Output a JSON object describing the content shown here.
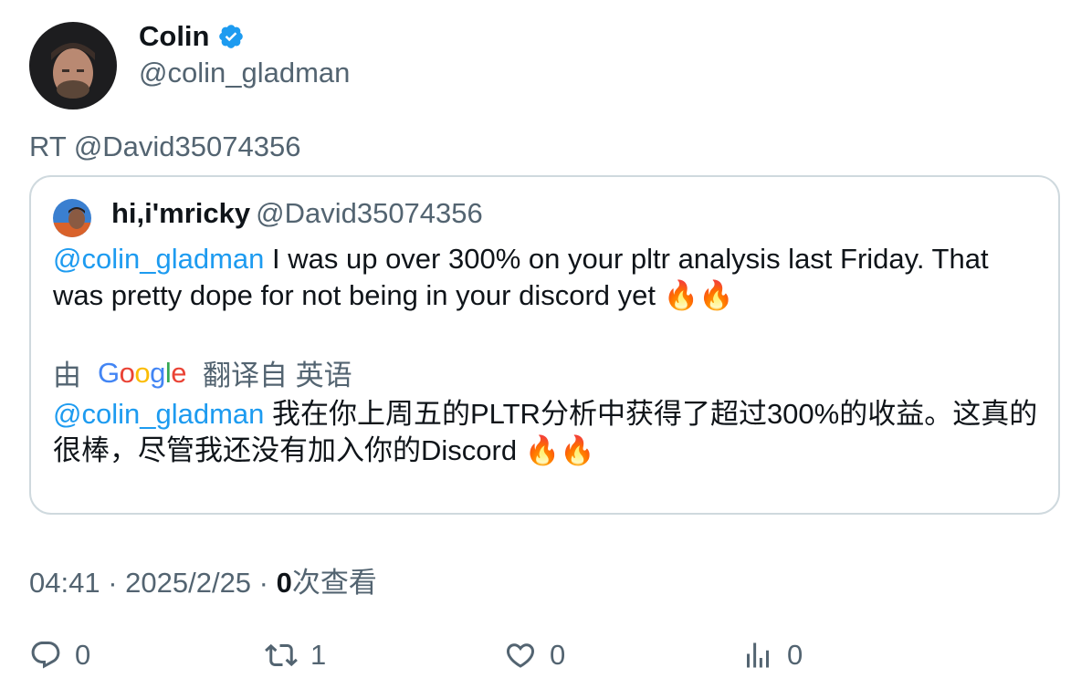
{
  "author": {
    "name": "Colin",
    "handle": "@colin_gladman"
  },
  "retweet_label": "RT @David35074356",
  "quoted": {
    "name": "hi,i'mricky",
    "handle": "@David35074356",
    "mention": "@colin_gladman",
    "text": " I was up over 300% on your pltr analysis last Friday. That was pretty dope for not being in your discord yet 🔥🔥",
    "translate_prefix": "由",
    "translate_brand": "Google",
    "translate_suffix": "翻译自 英语",
    "translated_mention": "@colin_gladman",
    "translated_text": " 我在你上周五的PLTR分析中获得了超过300%的收益。这真的很棒，尽管我还没有加入你的Discord 🔥🔥"
  },
  "meta": {
    "time": "04:41",
    "sep": " · ",
    "date": "2025/2/25",
    "views_count": "0",
    "views_label": "次查看"
  },
  "actions": {
    "reply_count": "0",
    "retweet_count": "1",
    "like_count": "0",
    "views_count": "0"
  },
  "colors": {
    "link": "#1d9bf0",
    "muted": "#536471",
    "text": "#0f1419",
    "border": "#cfd9de"
  },
  "icons": [
    "verified-icon",
    "reply-icon",
    "retweet-icon",
    "like-icon",
    "views-icon"
  ]
}
